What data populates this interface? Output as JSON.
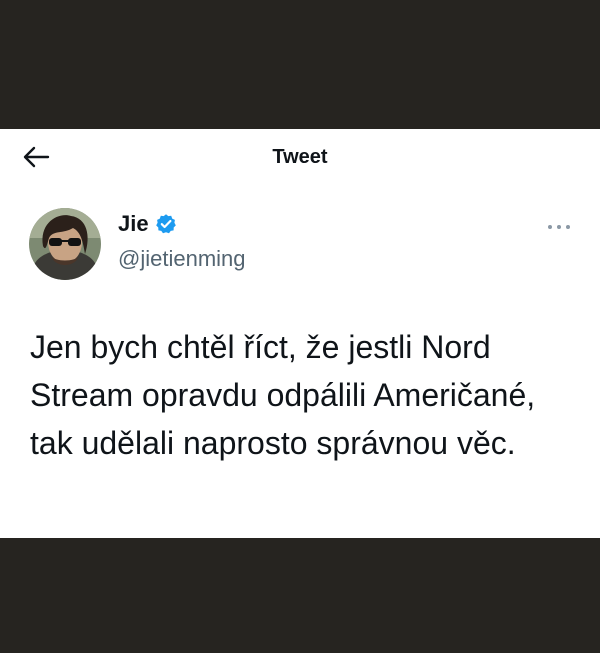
{
  "header": {
    "title": "Tweet"
  },
  "author": {
    "name": "Jie",
    "handle": "@jietienming",
    "verified": true
  },
  "tweet": {
    "text": "Jen bych chtěl říct, že jestli Nord Stream opravdu odpálili Američané, tak udělali naprosto správnou věc."
  },
  "colors": {
    "background": "#262420",
    "card": "#ffffff",
    "text_primary": "#0f1419",
    "text_secondary": "#536471",
    "verified_blue": "#1d9bf0"
  },
  "icons": {
    "back": "arrow-left-icon",
    "verified": "verified-badge-icon",
    "more": "more-horizontal-icon"
  }
}
